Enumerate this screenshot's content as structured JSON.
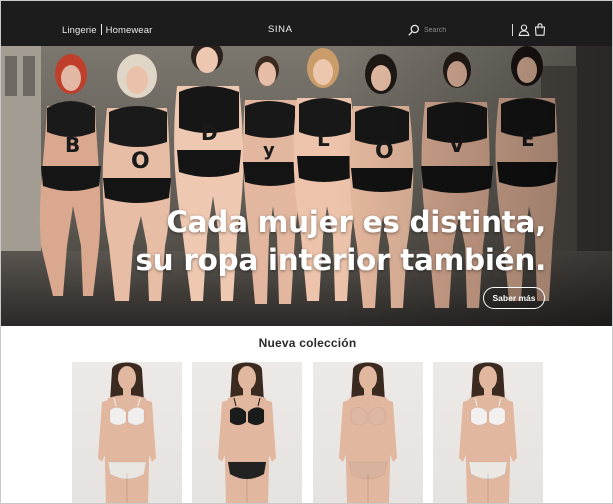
{
  "header": {
    "nav_items": [
      "Lingerie",
      "Homewear"
    ],
    "brand": "SINA",
    "search_placeholder": "Search",
    "icons": [
      "search-icon",
      "user-icon",
      "bag-icon"
    ]
  },
  "hero": {
    "headline_line1": "Cada mujer es distinta,",
    "headline_line2": "su ropa interior también.",
    "cta_label": "Saber más",
    "body_letters": [
      "B",
      "O",
      "D",
      "y",
      "L",
      "O",
      "V",
      "E"
    ]
  },
  "collection": {
    "title": "Nueva colección",
    "products": [
      {
        "name": "white-lace-set",
        "colors": {
          "bra": "#f1efed",
          "brief": "#e9e5e1"
        }
      },
      {
        "name": "black-lace-set",
        "colors": {
          "bra": "#1b1b1b",
          "brief": "#222222"
        }
      },
      {
        "name": "nude-set",
        "colors": {
          "bra": "#dcb7a2",
          "brief": "#d8b29c"
        }
      },
      {
        "name": "white-set",
        "colors": {
          "bra": "#f3f1ef",
          "brief": "#ebe7e3"
        }
      }
    ]
  },
  "colors": {
    "header_bg": "#1c1c1c",
    "header_text": "#e9e9e9",
    "page_bg": "#ffffff"
  }
}
